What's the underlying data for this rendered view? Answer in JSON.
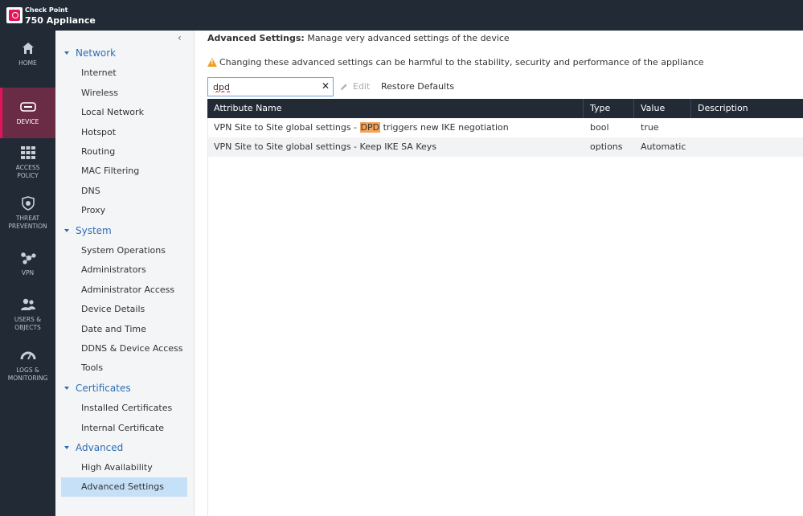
{
  "brand": {
    "line1": "Check Point",
    "line2": "750 Appliance"
  },
  "leftnav": [
    {
      "key": "home",
      "label": "HOME",
      "icon": "home-icon"
    },
    {
      "key": "device",
      "label": "DEVICE",
      "icon": "device-icon",
      "active": true
    },
    {
      "key": "access",
      "label": "ACCESS\nPOLICY",
      "icon": "grid-icon"
    },
    {
      "key": "threat",
      "label": "THREAT\nPREVENTION",
      "icon": "shield-icon"
    },
    {
      "key": "vpn",
      "label": "VPN",
      "icon": "vpn-icon"
    },
    {
      "key": "users",
      "label": "USERS &\nOBJECTS",
      "icon": "users-icon"
    },
    {
      "key": "logs",
      "label": "LOGS &\nMONITORING",
      "icon": "gauge-icon"
    }
  ],
  "tree": {
    "network": {
      "label": "Network",
      "items": [
        "Internet",
        "Wireless",
        "Local Network",
        "Hotspot",
        "Routing",
        "MAC Filtering",
        "DNS",
        "Proxy"
      ]
    },
    "system": {
      "label": "System",
      "items": [
        "System Operations",
        "Administrators",
        "Administrator Access",
        "Device Details",
        "Date and Time",
        "DDNS & Device Access",
        "Tools"
      ]
    },
    "certificates": {
      "label": "Certificates",
      "items": [
        "Installed Certificates",
        "Internal Certificate"
      ]
    },
    "advanced": {
      "label": "Advanced",
      "items": [
        "High Availability",
        "Advanced Settings"
      ]
    }
  },
  "main": {
    "title_bold": "Advanced Settings:",
    "title_rest": " Manage very advanced settings of the device",
    "warning": "Changing these advanced settings can be harmful to the stability, security and performance of the appliance",
    "search_value": "dpd",
    "edit_label": "Edit",
    "restore_label": "Restore Defaults"
  },
  "table": {
    "columns": [
      "Attribute Name",
      "Type",
      "Value",
      "Description"
    ],
    "rows": [
      {
        "name_pre": "VPN Site to Site global settings - ",
        "name_hl": "DPD",
        "name_post": " triggers new IKE negotiation",
        "type": "bool",
        "value": "true",
        "description": ""
      },
      {
        "name_pre": "VPN Site to Site global settings - Keep IKE SA Keys",
        "name_hl": "",
        "name_post": "",
        "type": "options",
        "value": "Automatic",
        "description": ""
      }
    ]
  },
  "colors": {
    "nav_bg": "#222a36",
    "active_bg": "#6a2c45",
    "accent": "#e4145b",
    "tree_bg": "#f4f5f7",
    "selected": "#c5e0f7",
    "link": "#2d6db5",
    "highlight": "#f5a45a"
  }
}
